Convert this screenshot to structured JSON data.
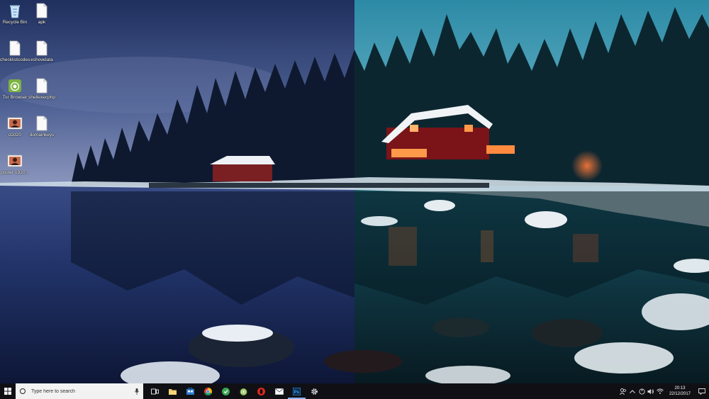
{
  "desktop": {
    "icons": [
      {
        "label": "Recycle Bin",
        "icon": "recycle-bin-icon"
      },
      {
        "label": "apk",
        "icon": "file-icon"
      },
      {
        "label": "checklistcodes",
        "icon": "file-icon"
      },
      {
        "label": "eshowdata",
        "icon": "file-icon"
      },
      {
        "label": "Tor Browser",
        "icon": "tor-browser-icon"
      },
      {
        "label": "shellexecphp",
        "icon": "file-icon"
      },
      {
        "label": "d2d20",
        "icon": "image-icon"
      },
      {
        "label": "domainkeys",
        "icon": "file-icon"
      },
      {
        "label": "poster 1920...",
        "icon": "image-icon"
      }
    ]
  },
  "taskbar": {
    "search_placeholder": "Type here to search",
    "apps": [
      "task-view-icon",
      "file-explorer-icon",
      "store-icon",
      "chrome-icon",
      "app-green-icon",
      "tor-browser-icon",
      "opera-icon",
      "mail-icon",
      "photoshop-icon",
      "settings-icon"
    ],
    "clock": {
      "time": "20:13",
      "date": "22/12/2017"
    }
  },
  "colors": {
    "taskbar": "#101014",
    "accent": "#8ab4f8"
  }
}
